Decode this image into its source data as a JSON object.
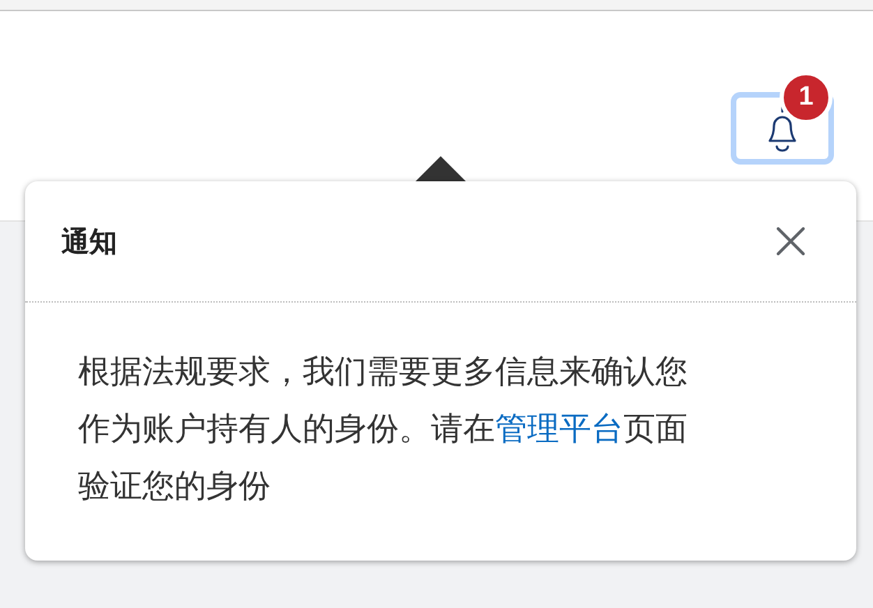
{
  "header": {
    "notifications_button": {
      "badge": "1",
      "focused": true
    }
  },
  "popover": {
    "title": "通知",
    "message": {
      "before": "根据法规要求，我们需要更多信息来确认您作为账户持有人的身份。请在",
      "link": "管理平台",
      "after": "页面验证您的身份"
    }
  }
}
